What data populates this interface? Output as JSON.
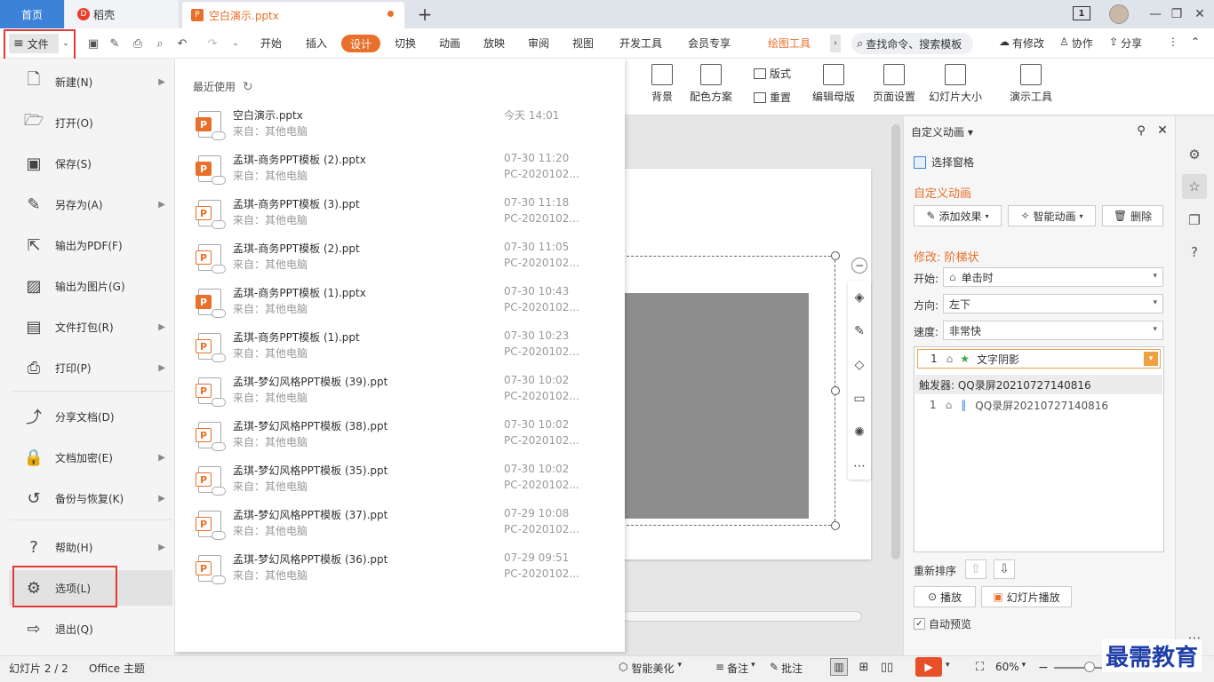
{
  "tabs": {
    "home": "首页",
    "daoke": "稻壳",
    "document": "空白演示.pptx"
  },
  "titlebar": {
    "badge": "1"
  },
  "menubar": {
    "file": "文件",
    "items": [
      "开始",
      "插入",
      "设计",
      "切换",
      "动画",
      "放映",
      "审阅",
      "视图",
      "开发工具",
      "会员专享"
    ],
    "active": "设计",
    "draw_tools": "绘图工具",
    "search_placeholder": "查找命令、搜索模板",
    "has_changes": "有修改",
    "collaborate": "协作",
    "share": "分享"
  },
  "ribbon": {
    "layout": "版式",
    "reset": "重置",
    "background": "背景",
    "color_scheme": "配色方案",
    "edit_master": "编辑母版",
    "page_setup": "页面设置",
    "slide_size": "幻灯片大小",
    "demo_tools": "演示工具"
  },
  "file_menu": {
    "items": [
      {
        "label": "新建(N)",
        "icon": "new-doc-icon",
        "arrow": true
      },
      {
        "label": "打开(O)",
        "icon": "folder-open-icon",
        "arrow": false
      },
      {
        "label": "保存(S)",
        "icon": "save-icon",
        "arrow": false
      },
      {
        "label": "另存为(A)",
        "icon": "save-as-icon",
        "arrow": true
      },
      {
        "label": "输出为PDF(F)",
        "icon": "pdf-export-icon",
        "arrow": false
      },
      {
        "label": "输出为图片(G)",
        "icon": "image-export-icon",
        "arrow": false
      },
      {
        "label": "文件打包(R)",
        "icon": "package-icon",
        "arrow": true
      },
      {
        "label": "打印(P)",
        "icon": "print-icon",
        "arrow": true
      },
      {
        "label": "分享文档(D)",
        "icon": "share-doc-icon",
        "arrow": false
      },
      {
        "label": "文档加密(E)",
        "icon": "encrypt-icon",
        "arrow": true
      },
      {
        "label": "备份与恢复(K)",
        "icon": "backup-icon",
        "arrow": true
      },
      {
        "label": "帮助(H)",
        "icon": "help-icon",
        "arrow": true
      },
      {
        "label": "选项(L)",
        "icon": "gear-icon",
        "arrow": false
      },
      {
        "label": "退出(Q)",
        "icon": "exit-icon",
        "arrow": false
      }
    ],
    "recent_title": "最近使用",
    "recent": [
      {
        "name": "空白演示.pptx",
        "source": "来自：其他电脑",
        "time": "今天 14:01",
        "pc": "",
        "orange": true
      },
      {
        "name": "孟琪-商务PPT模板 (2).pptx",
        "source": "来自：其他电脑",
        "time": "07-30 11:20",
        "pc": "PC-2020102...",
        "orange": true
      },
      {
        "name": "孟琪-商务PPT模板 (3).ppt",
        "source": "来自：其他电脑",
        "time": "07-30 11:18",
        "pc": "PC-2020102...",
        "orange": false
      },
      {
        "name": "孟琪-商务PPT模板 (2).ppt",
        "source": "来自：其他电脑",
        "time": "07-30 11:05",
        "pc": "PC-2020102...",
        "orange": false
      },
      {
        "name": "孟琪-商务PPT模板 (1).pptx",
        "source": "来自：其他电脑",
        "time": "07-30 10:43",
        "pc": "PC-2020102...",
        "orange": true
      },
      {
        "name": "孟琪-商务PPT模板 (1).ppt",
        "source": "来自：其他电脑",
        "time": "07-30 10:23",
        "pc": "PC-2020102...",
        "orange": false
      },
      {
        "name": "孟琪-梦幻风格PPT模板 (39).ppt",
        "source": "来自：其他电脑",
        "time": "07-30 10:02",
        "pc": "PC-2020102...",
        "orange": false
      },
      {
        "name": "孟琪-梦幻风格PPT模板 (38).ppt",
        "source": "来自：其他电脑",
        "time": "07-30 10:02",
        "pc": "PC-2020102...",
        "orange": false
      },
      {
        "name": "孟琪-梦幻风格PPT模板 (35).ppt",
        "source": "来自：其他电脑",
        "time": "07-30 10:02",
        "pc": "PC-2020102...",
        "orange": false
      },
      {
        "name": "孟琪-梦幻风格PPT模板 (37).ppt",
        "source": "来自：其他电脑",
        "time": "07-29 10:08",
        "pc": "PC-2020102...",
        "orange": false
      },
      {
        "name": "孟琪-梦幻风格PPT模板 (36).ppt",
        "source": "来自：其他电脑",
        "time": "07-29 09:51",
        "pc": "PC-2020102...",
        "orange": false
      }
    ]
  },
  "animation_panel": {
    "title": "自定义动画",
    "selection_pane": "选择窗格",
    "section": "自定义动画",
    "add_effect": "添加效果",
    "smart_anim": "智能动画",
    "delete": "删除",
    "modify": "修改: 阶梯状",
    "start_label": "开始:",
    "start_value": "单击时",
    "direction_label": "方向:",
    "direction_value": "左下",
    "speed_label": "速度:",
    "speed_value": "非常快",
    "list_item_index": "1",
    "list_item": "文字阴影",
    "trigger": "触发器: QQ录屏20210727140816",
    "trigger_item_index": "1",
    "trigger_item": "QQ录屏20210727140816",
    "reorder": "重新排序",
    "play": "播放",
    "slideshow": "幻灯片播放",
    "auto_preview": "自动预览"
  },
  "statusbar": {
    "slide": "幻灯片 2 / 2",
    "theme": "Office 主题",
    "smart_beautify": "智能美化",
    "notes": "备注",
    "comments": "批注",
    "zoom": "60%"
  },
  "watermark": "最需教育",
  "colors": {
    "accent": "#e8702a",
    "home_tab": "#3b82d8",
    "highlight": "#e53935"
  }
}
